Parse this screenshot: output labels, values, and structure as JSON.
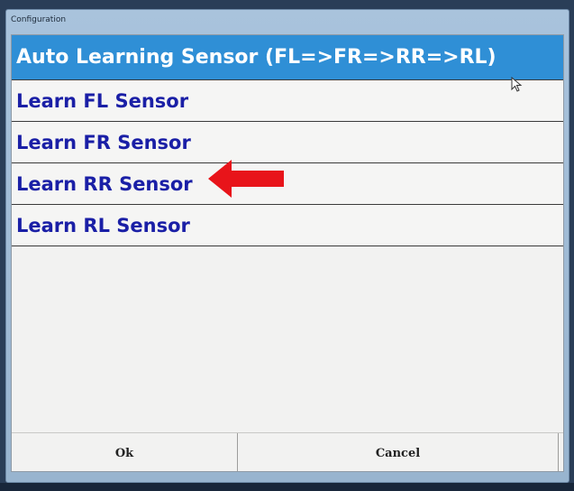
{
  "window": {
    "title": "Configuration"
  },
  "list": {
    "items": [
      {
        "label": "Auto Learning Sensor (FL=>FR=>RR=>RL)",
        "selected": true
      },
      {
        "label": "Learn FL Sensor",
        "selected": false
      },
      {
        "label": "Learn FR Sensor",
        "selected": false
      },
      {
        "label": "Learn RR Sensor",
        "selected": false
      },
      {
        "label": "Learn RL Sensor",
        "selected": false
      }
    ]
  },
  "buttons": {
    "ok_label": "Ok",
    "cancel_label": "Cancel"
  },
  "colors": {
    "selected_bg": "#2f8fd6",
    "item_text": "#1a1fa6",
    "annotation_arrow": "#e8141a"
  },
  "annotation": {
    "icon": "red-arrow-icon",
    "points_to": "Learn FR Sensor"
  }
}
